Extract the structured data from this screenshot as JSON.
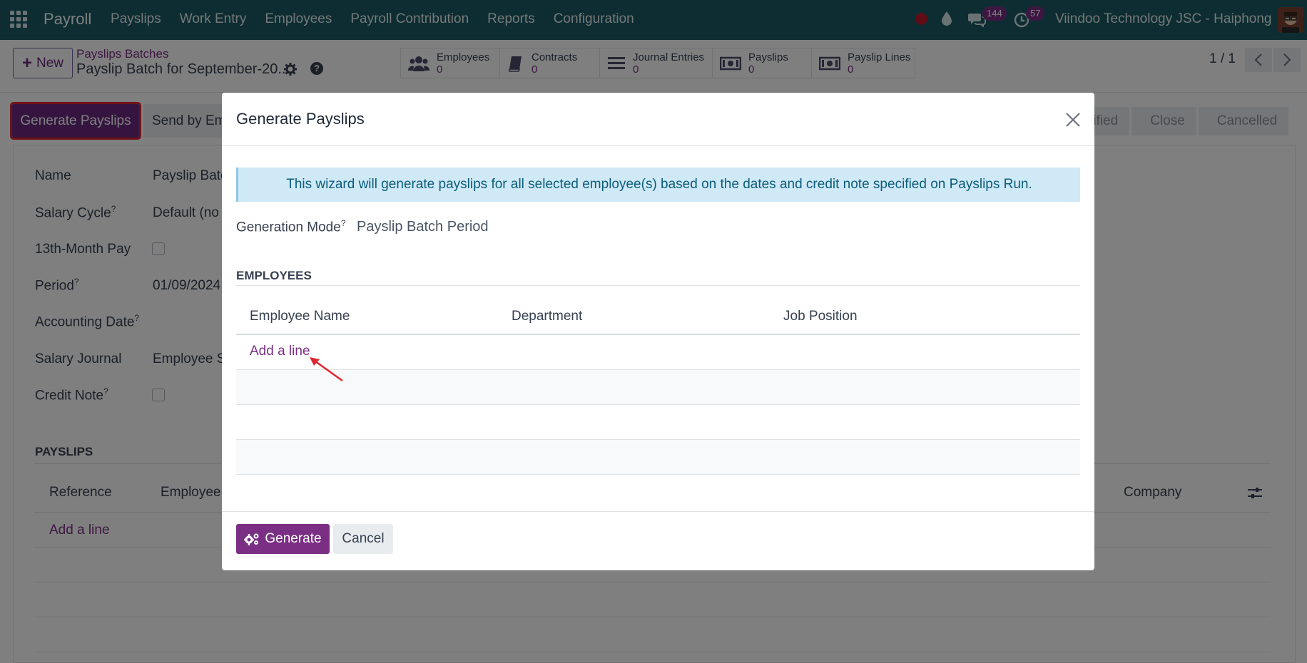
{
  "navbar": {
    "brand": "Payroll",
    "menu": [
      "Payslips",
      "Work Entry",
      "Employees",
      "Payroll Contribution",
      "Reports",
      "Configuration"
    ],
    "chat_count": "144",
    "activity_count": "57",
    "company": "Viindoo Technology JSC - Haiphong"
  },
  "control": {
    "new_label": "New",
    "breadcrumb_parent": "Payslips Batches",
    "breadcrumb_current": "Payslip Batch for September-20...",
    "smart_buttons": [
      {
        "label": "Employees",
        "value": "0",
        "icon": "users-icon"
      },
      {
        "label": "Contracts",
        "value": "0",
        "icon": "book-icon"
      },
      {
        "label": "Journal Entries",
        "value": "0",
        "icon": "list-icon"
      },
      {
        "label": "Payslips",
        "value": "0",
        "icon": "money-icon"
      },
      {
        "label": "Payslip Lines",
        "value": "0",
        "icon": "money-icon"
      }
    ],
    "pager": "1 / 1"
  },
  "actions": {
    "generate_payslips": "Generate Payslips",
    "send_by_email": "Send by Em",
    "statuses": [
      "rified",
      "Close",
      "Cancelled"
    ]
  },
  "form": {
    "name_label": "Name",
    "name_value": "Payslip Batc",
    "salary_cycle_label": "Salary Cycle",
    "salary_cycle_value": "Default (no",
    "thirteenth_label": "13th-Month Pay",
    "period_label": "Period",
    "period_value": "01/09/2024",
    "accounting_date_label": "Accounting Date",
    "salary_journal_label": "Salary Journal",
    "salary_journal_value": "Employee S",
    "credit_note_label": "Credit Note",
    "payslips_title": "PAYSLIPS",
    "payslips_columns": [
      "Reference",
      "Employee",
      "Company"
    ],
    "payslips_add_line": "Add a line"
  },
  "modal": {
    "title": "Generate Payslips",
    "alert": "This wizard will generate payslips for all selected employee(s) based on the dates and credit note specified on Payslips Run.",
    "generation_mode_label": "Generation Mode",
    "generation_mode_value": "Payslip Batch Period",
    "employees_title": "EMPLOYEES",
    "columns": [
      "Employee Name",
      "Department",
      "Job Position"
    ],
    "add_line": "Add a line",
    "generate_label": "Generate",
    "cancel_label": "Cancel"
  },
  "colors": {
    "navbar": "#1a5a64",
    "primary": "#7b2f84",
    "highlight": "#e0262d",
    "alert_bg": "#cfe9f6"
  }
}
